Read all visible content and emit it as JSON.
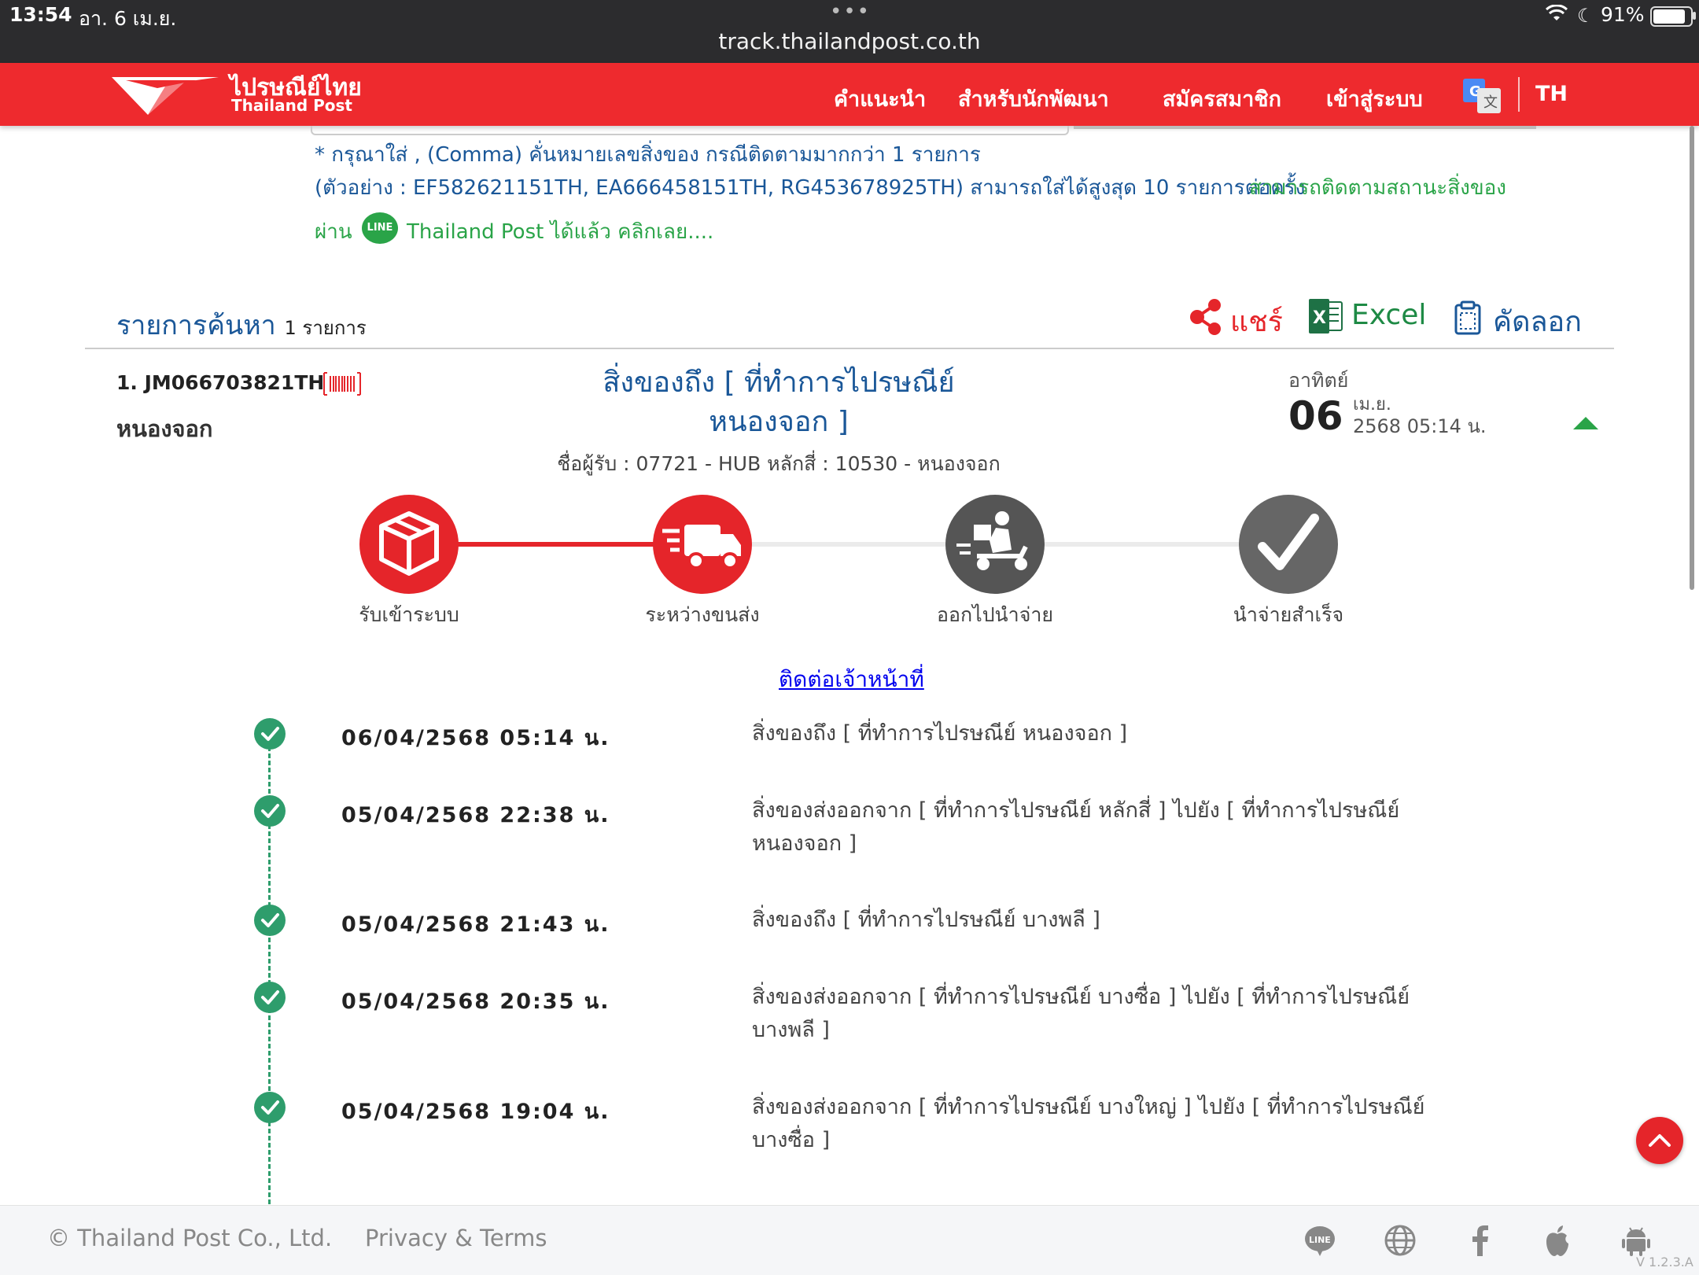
{
  "status_bar": {
    "time": "13:54",
    "date": "อา. 6 เม.ย.",
    "url": "track.thailandpost.co.th",
    "battery": "91%",
    "battery_level": 0.91
  },
  "header": {
    "logo_th": "ไปรษณีย์ไทย",
    "logo_en": "Thailand Post",
    "nav": [
      "คำแนะนำ",
      "สำหรับนักพัฒนา",
      "สมัครสมาชิก",
      "เข้าสู่ระบบ"
    ],
    "language": "TH"
  },
  "notes": {
    "line1": "* กรุณาใส่ , (Comma) คั่นหมายเลขสิ่งของ กรณีติดตามมากกว่า 1 รายการ",
    "line2": "(ตัวอย่าง : EF582621151TH, EA666458151TH, RG453678925TH) สามารถใส่ได้สูงสุด 10 รายการต่อครั้ง",
    "line2_green": "สามารถติดตามสถานะสิ่งของ",
    "line3_prefix": "ผ่าน",
    "line_badge": "LINE",
    "line3_link": "Thailand Post ได้แล้ว คลิกเลย...."
  },
  "results": {
    "title": "รายการค้นหา",
    "count": "1 รายการ",
    "share_label": "แชร์",
    "excel_label": "Excel",
    "copy_label": "คัดลอก"
  },
  "item": {
    "id": "1. JM066703821TH",
    "location": "หนองจอก",
    "status_line1": "สิ่งของถึง [ ที่ทำการไปรษณีย์",
    "status_line2": "หนองจอก ]",
    "receiver": "ชื่อผู้รับ : 07721 - HUB หลักสี่ : 10530 - หนองจอก",
    "day_name": "อาทิตย์",
    "day_num": "06",
    "month": "เม.ย.",
    "year_time": "2568  05:14 น."
  },
  "steps": [
    {
      "label": "รับเข้าระบบ",
      "icon": "box-icon",
      "color": "#e5252a"
    },
    {
      "label": "ระหว่างขนส่ง",
      "icon": "truck-icon",
      "color": "#e5252a"
    },
    {
      "label": "ออกไปนำจ่าย",
      "icon": "delivery-scooter-icon",
      "color": "#555555"
    },
    {
      "label": "นำจ่ายสำเร็จ",
      "icon": "checkmark-icon",
      "color": "#666666"
    }
  ],
  "progress": {
    "completed_steps": 2,
    "total_steps": 4
  },
  "contact_link": "ติดต่อเจ้าหน้าที่",
  "timeline": [
    {
      "date": "06/04/2568 05:14 น.",
      "desc": "สิ่งของถึง [ ที่ทำการไปรษณีย์ หนองจอก ]"
    },
    {
      "date": "05/04/2568 22:38 น.",
      "desc": "สิ่งของส่งออกจาก [ ที่ทำการไปรษณีย์ หลักสี่ ] ไปยัง [ ที่ทำการไปรษณีย์ หนองจอก ]"
    },
    {
      "date": "05/04/2568 21:43 น.",
      "desc": "สิ่งของถึง [ ที่ทำการไปรษณีย์ บางพลี ]"
    },
    {
      "date": "05/04/2568 20:35 น.",
      "desc": "สิ่งของส่งออกจาก [ ที่ทำการไปรษณีย์ บางซื่อ ] ไปยัง [ ที่ทำการไปรษณีย์ บางพลี ]"
    },
    {
      "date": "05/04/2568 19:04 น.",
      "desc": "สิ่งของส่งออกจาก [ ที่ทำการไปรษณีย์ บางใหญ่ ] ไปยัง [ ที่ทำการไปรษณีย์ บางซื่อ ]"
    }
  ],
  "footer": {
    "copyright": "© Thailand Post Co., Ltd.",
    "privacy": "Privacy & Terms",
    "version": "V 1.2.3.A"
  },
  "colors": {
    "brand_red": "#ee2a2e",
    "link_blue": "#1a5798",
    "green": "#2aa448",
    "timeline_green": "#2e9d6c"
  }
}
